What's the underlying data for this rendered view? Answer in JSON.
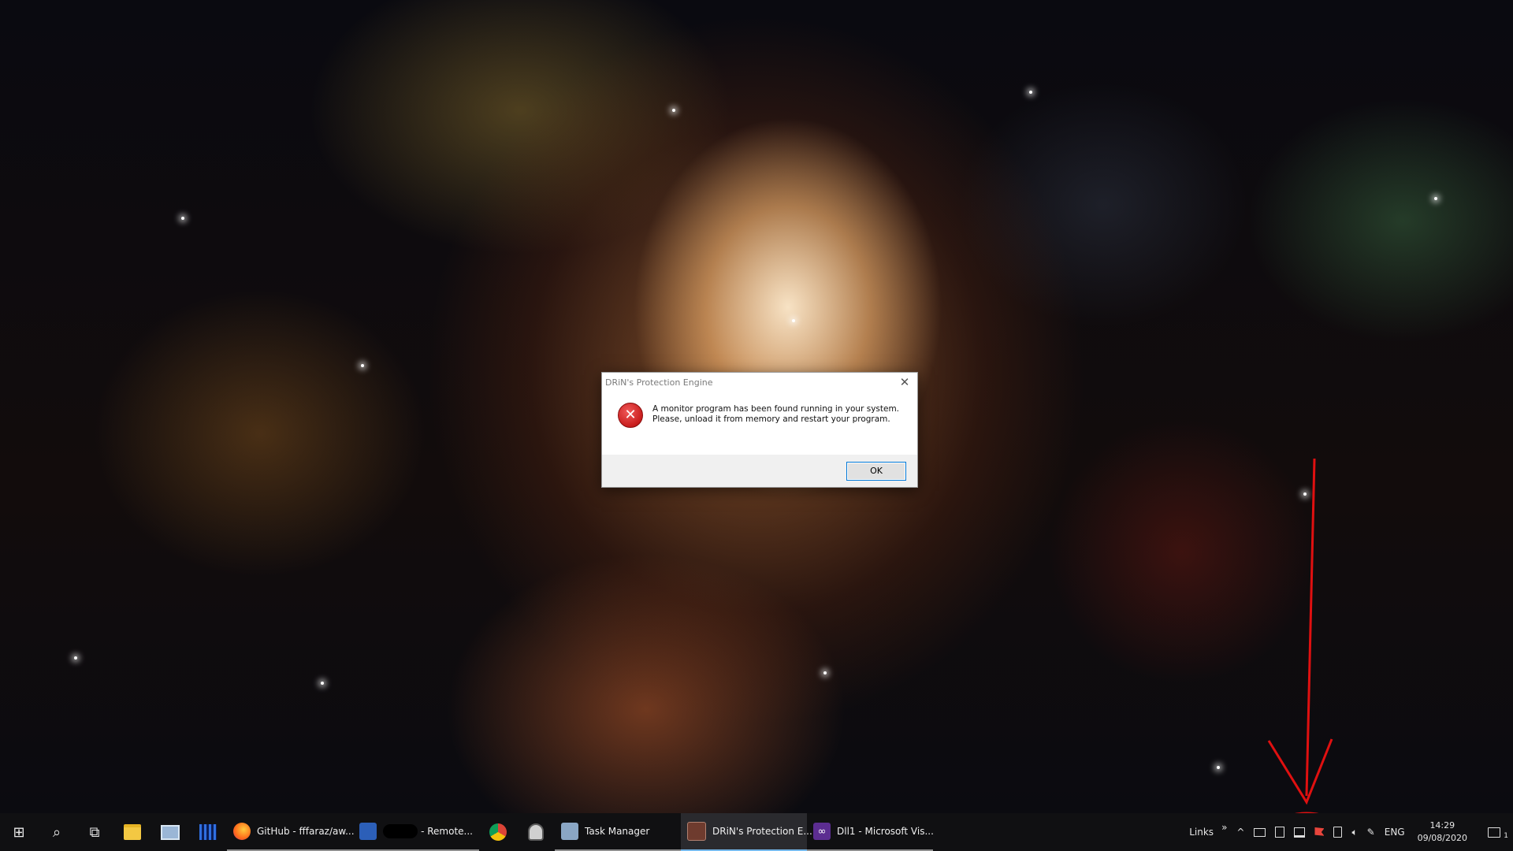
{
  "dialog": {
    "title": "DRiN's Protection Engine",
    "close_glyph": "✕",
    "message_line1": "A monitor program has been found running in your system.",
    "message_line2": "Please, unload it from memory and restart your program.",
    "ok_label": "OK",
    "icon": "error-icon"
  },
  "taskbar": {
    "pinned": [
      {
        "name": "start-button",
        "glyph": "⊞"
      },
      {
        "name": "search-button",
        "glyph": "⌕"
      },
      {
        "name": "task-view-button",
        "glyph": "⧉"
      }
    ],
    "apps": [
      {
        "label": "GitHub - fffaraz/aw...",
        "icon": "firefox-icon"
      },
      {
        "label": "- Remote...",
        "icon": "remote-desktop-icon"
      },
      {
        "label": "Task Manager",
        "icon": "task-manager-icon"
      },
      {
        "label": "DRiN's Protection E...",
        "icon": "drin-app-icon"
      },
      {
        "label": "Dll1 - Microsoft Vis...",
        "icon": "visual-studio-icon"
      }
    ],
    "tray": {
      "links_label": "Links",
      "overflow_glyph": "»",
      "chevron_glyph": "^",
      "language": "ENG",
      "time": "14:29",
      "date": "09/08/2020",
      "notification_count": "1"
    }
  },
  "colors": {
    "accent": "#0078d7",
    "active_underline": "#76b9ed",
    "annotation": "#e01010",
    "error": "#c81d1d"
  }
}
